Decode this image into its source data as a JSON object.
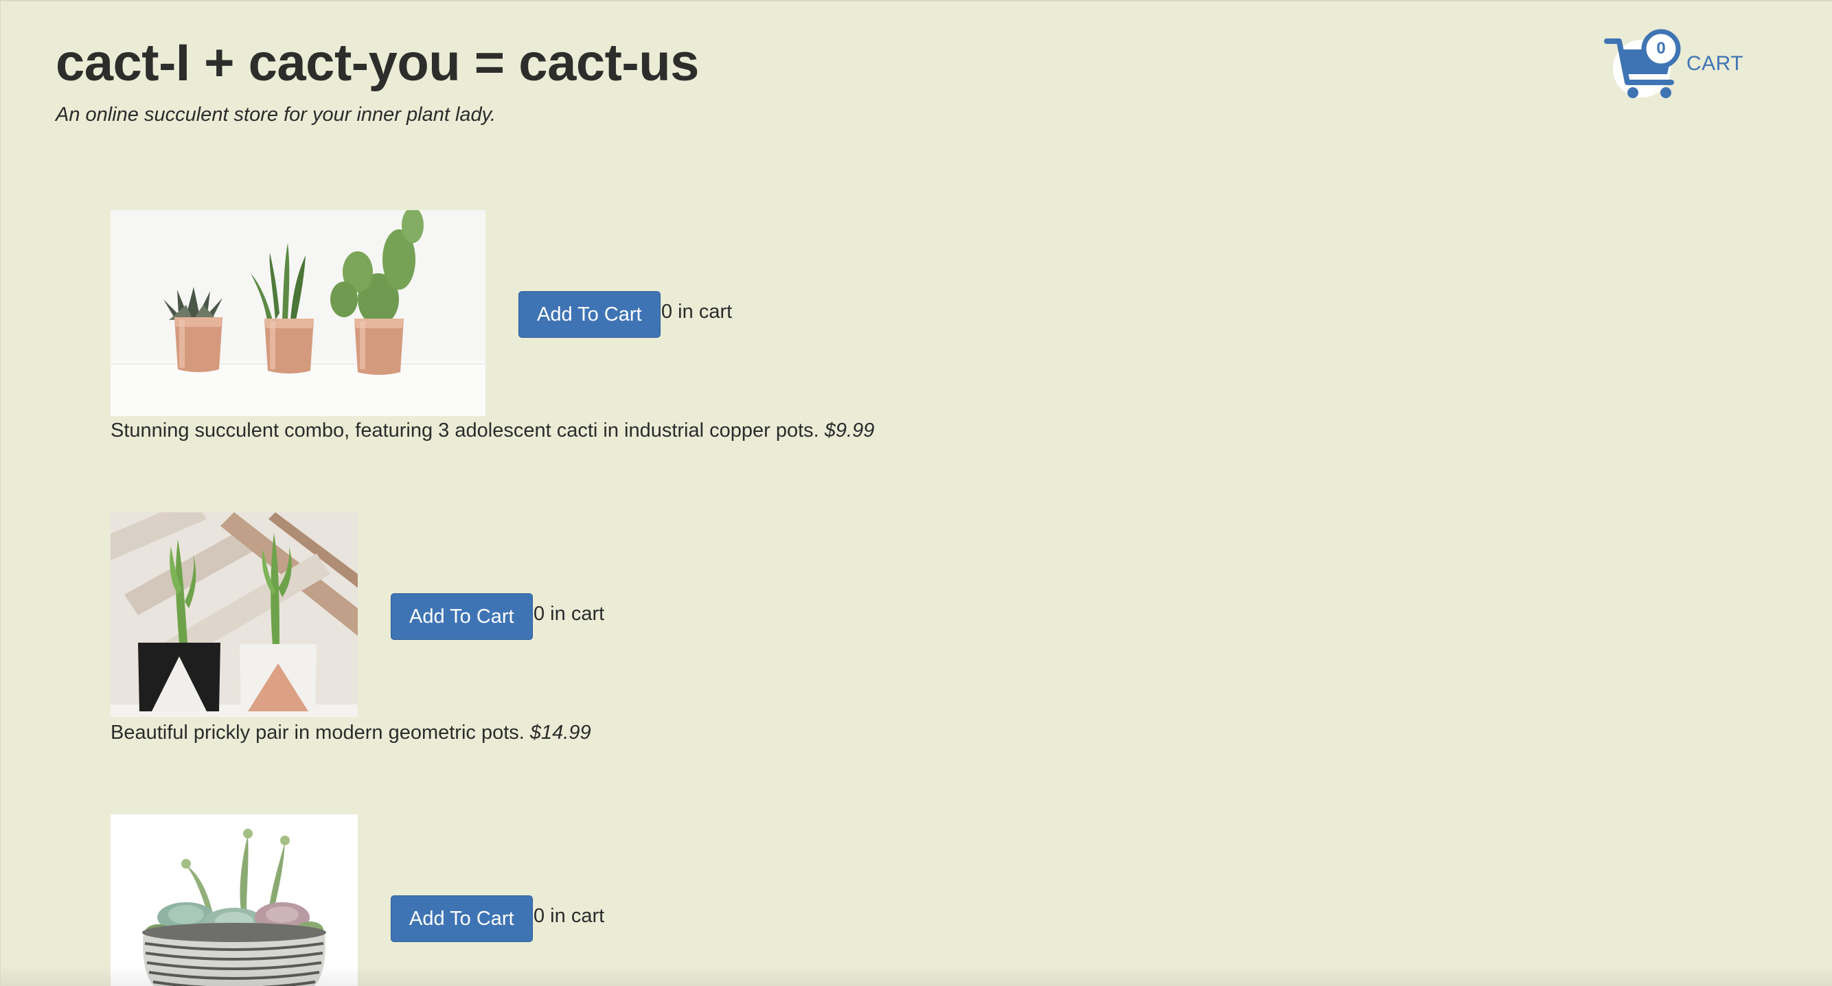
{
  "header": {
    "title": "cact-I + cact-you = cact-us",
    "tagline": "An online succulent store for your inner plant lady."
  },
  "cart": {
    "count": "0",
    "label": "CART",
    "icon": "shopping-cart-icon"
  },
  "products": [
    {
      "image": "three-cacti-copper-pots",
      "button_label": "Add To Cart",
      "in_cart": "0 in cart",
      "description": "Stunning succulent combo, featuring 3 adolescent cacti in industrial copper pots.",
      "price": "$9.99"
    },
    {
      "image": "two-cacti-geometric-pots",
      "button_label": "Add To Cart",
      "in_cart": "0 in cart",
      "description": "Beautiful prickly pair in modern geometric pots.",
      "price": "$14.99"
    },
    {
      "image": "succulent-bowl-striped-planter",
      "button_label": "Add To Cart",
      "in_cart": "0 in cart"
    }
  ],
  "colors": {
    "background": "#ebecd6",
    "accent": "#3f74b4",
    "text": "#2b2b2b"
  }
}
